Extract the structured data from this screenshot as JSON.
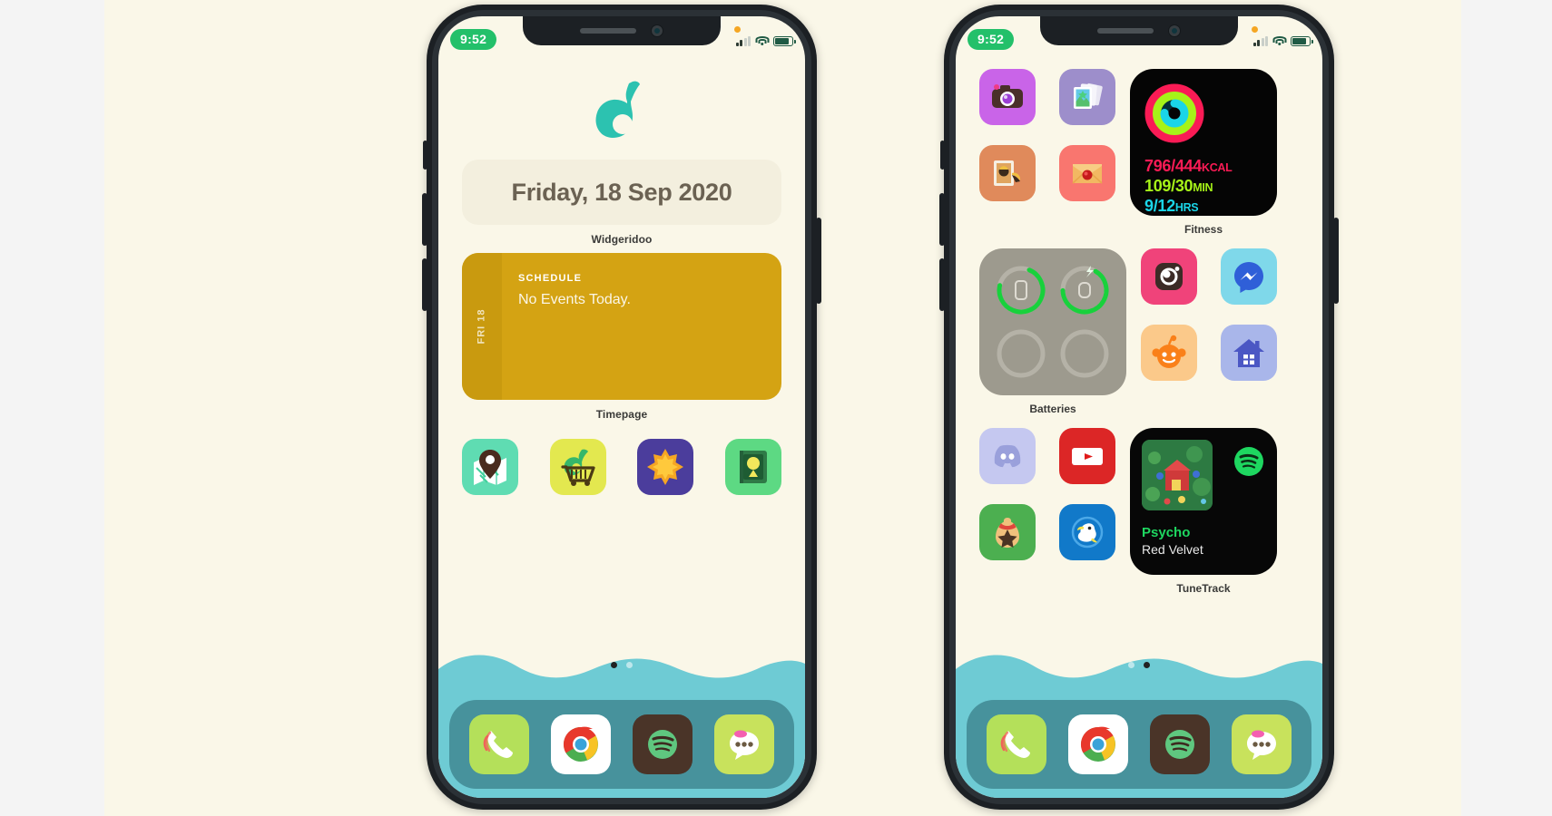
{
  "theme": {
    "canvas_bg": "#faf7e8",
    "page_bg": "#f4f4f4",
    "accent_green": "#23c06a",
    "water": "#6ecbd4",
    "dock_bg": "rgba(40,100,110,0.55)",
    "timepage_yellow": "#d4a313",
    "leaf_teal": "#2cc2b0"
  },
  "phones": [
    {
      "id": "phone-left",
      "status_bar": {
        "time": "9:52",
        "recording_indicator": "orange-dot-icon",
        "signal_icon": "cellular-bars-icon",
        "wifi_icon": "wifi-icon",
        "battery_icon": "battery-icon"
      },
      "hero_icon": "acnh-leaf-icon",
      "date_widget": {
        "date_text": "Friday, 18 Sep 2020",
        "label": "Widgeridoo"
      },
      "timepage_widget": {
        "rail_text": "FRI 18",
        "kicker": "SCHEDULE",
        "body": "No Events Today.",
        "label": "Timepage"
      },
      "app_icons": [
        {
          "name": "map-app",
          "icon": "map-pin-icon",
          "bg": "#5fdcb2"
        },
        {
          "name": "nook-shopping-app",
          "icon": "shopping-cart-leaf-icon",
          "bg": "#e3e84f"
        },
        {
          "name": "star-fragment-app",
          "icon": "star-flower-icon",
          "bg": "#4b3d9c"
        },
        {
          "name": "critterpedia-app",
          "icon": "green-book-icon",
          "bg": "#5dd983"
        }
      ],
      "page_dots": {
        "count": 2,
        "active_index": 0
      },
      "dock": [
        {
          "name": "phone-app",
          "icon": "phone-handset-icon",
          "bg": "#b4e05a"
        },
        {
          "name": "chrome-app",
          "icon": "chrome-icon",
          "bg": "#ffffff"
        },
        {
          "name": "spotify-app",
          "icon": "spotify-icon",
          "bg": "#4a3428"
        },
        {
          "name": "messages-app",
          "icon": "speech-bubble-icon",
          "bg": "#c8e25c"
        }
      ]
    },
    {
      "id": "phone-right",
      "status_bar": {
        "time": "9:52",
        "recording_indicator": "orange-dot-icon",
        "signal_icon": "cellular-bars-icon",
        "wifi_icon": "wifi-icon",
        "battery_icon": "battery-icon"
      },
      "grid_row1_icons": [
        {
          "name": "camera-app",
          "icon": "camera-icon",
          "bg": "#c964e8"
        },
        {
          "name": "photos-app",
          "icon": "photo-stack-icon",
          "bg": "#9d8ecb"
        },
        {
          "name": "nook-photo-app",
          "icon": "framed-photo-icon",
          "bg": "#e08a5b"
        },
        {
          "name": "mail-app",
          "icon": "envelope-seal-icon",
          "bg": "#f9766f"
        }
      ],
      "fitness_widget": {
        "label": "Fitness",
        "rings": [
          "move-ring",
          "exercise-ring",
          "stand-ring"
        ],
        "lines": [
          {
            "value": "796/444",
            "unit": "KCAL",
            "color": "#fa1b55"
          },
          {
            "value": "109/30",
            "unit": "MIN",
            "color": "#a6f318"
          },
          {
            "value": "9/12",
            "unit": "HRS",
            "color": "#1ad5e8"
          }
        ]
      },
      "batteries_widget": {
        "label": "Batteries",
        "cells": [
          {
            "name": "iphone-battery-ring",
            "device_icon": "iphone-icon",
            "percent": 72,
            "charging": false
          },
          {
            "name": "watch-battery-ring",
            "device_icon": "apple-watch-icon",
            "percent": 66,
            "charging": true
          },
          {
            "name": "empty-battery-ring-1",
            "device_icon": "",
            "percent": 0,
            "charging": false
          },
          {
            "name": "empty-battery-ring-2",
            "device_icon": "",
            "percent": 0,
            "charging": false
          }
        ]
      },
      "grid_row2_icons": [
        {
          "name": "instagram-app",
          "icon": "instagram-icon",
          "bg": "#f0437a"
        },
        {
          "name": "messenger-app",
          "icon": "messenger-icon",
          "bg": "#7fd8ea"
        },
        {
          "name": "reddit-app",
          "icon": "reddit-icon",
          "bg": "#fbc98a"
        },
        {
          "name": "home-app",
          "icon": "house-icon",
          "bg": "#a9b6ea"
        }
      ],
      "grid_row3_icons": [
        {
          "name": "discord-app",
          "icon": "discord-icon",
          "bg": "#c5c8f0"
        },
        {
          "name": "youtube-app",
          "icon": "youtube-icon",
          "bg": "#dc2626"
        },
        {
          "name": "bells-app",
          "icon": "bell-bag-icon",
          "bg": "#4caf50"
        },
        {
          "name": "dodo-airlines-app",
          "icon": "dodo-bird-icon",
          "bg": "#1179c9"
        }
      ],
      "tunetrack_widget": {
        "label": "TuneTrack",
        "track_title": "Psycho",
        "artist": "Red Velvet",
        "service_icon": "spotify-icon",
        "album_art": "album-art-icon"
      },
      "page_dots": {
        "count": 2,
        "active_index": 1
      },
      "dock": [
        {
          "name": "phone-app",
          "icon": "phone-handset-icon",
          "bg": "#b4e05a"
        },
        {
          "name": "chrome-app",
          "icon": "chrome-icon",
          "bg": "#ffffff"
        },
        {
          "name": "spotify-app",
          "icon": "spotify-icon",
          "bg": "#4a3428"
        },
        {
          "name": "messages-app",
          "icon": "speech-bubble-icon",
          "bg": "#c8e25c"
        }
      ]
    }
  ]
}
